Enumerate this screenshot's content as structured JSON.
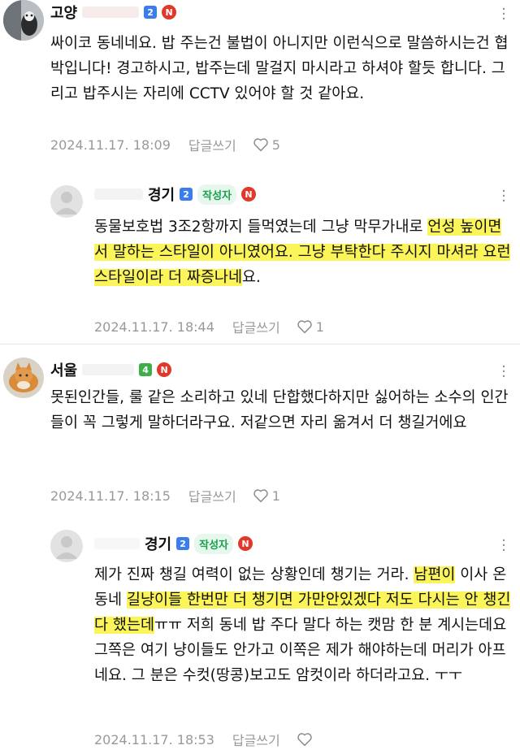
{
  "comments": [
    {
      "author": "고양",
      "level": "2",
      "level_color": "#3b7df0",
      "text": "싸이코 동네네요. 밥 주는건 불법이 아니지만 이런식으로 말씀하시는건 협박입니다! 경고하시고, 밥주는데 말걸지 마시라고 하셔야 할듯 합니다. 그리고 밥주시는 자리에 CCTV 있어야 할 것 같아요.",
      "date": "2024.11.17. 18:09",
      "reply_label": "답글쓰기",
      "likes": "5"
    },
    {
      "author": "경기",
      "level": "2",
      "level_color": "#3b7df0",
      "author_badge": "작성자",
      "text_parts": [
        {
          "t": "동물보호법 3조2항까지 들먹였는데 그냥 막무가내로 ",
          "h": false
        },
        {
          "t": "언성 높이면서 말하는 스타일이 아니였어요. 그냥 부탁한다 주시지 마셔라 요런 스타일이라 더 짜증나네",
          "h": true
        },
        {
          "t": "요.",
          "h": false
        }
      ],
      "date": "2024.11.17. 18:44",
      "reply_label": "답글쓰기",
      "likes": "1"
    },
    {
      "author": "서울",
      "level": "4",
      "level_color": "#3fae49",
      "text": "못된인간들, 룰 같은 소리하고 있네 단합했다하지만 싫어하는 소수의 인간들이 꼭 그렇게 말하더라구요. 저같으면 자리 옮겨서 더 챙길거에요",
      "date": "2024.11.17. 18:15",
      "reply_label": "답글쓰기",
      "likes": "1"
    },
    {
      "author": "경기",
      "level": "2",
      "level_color": "#3b7df0",
      "author_badge": "작성자",
      "text_parts": [
        {
          "t": "제가 진짜 챙길 여력이 없는 상황인데 챙기는 거라. ",
          "h": false
        },
        {
          "t": "남편이",
          "h": true
        },
        {
          "t": " 이사 온 동네 ",
          "h": false
        },
        {
          "t": "길냥이들 한번만 더 챙기면 가만안있겠다 저도 다시는 안 챙긴다 했는데",
          "h": true
        },
        {
          "t": "ㅠㅠ 저희 동네 밥 주다 말다 하는 캣맘 한 분 계시는데요 그쪽은 여기 냥이들도 안가고 이쪽은 제가 해야하는데 머리가 아프네요. 그 분은 수컷(땅콩)보고도 암컷이라 하더라고요. ㅜㅜ",
          "h": false
        }
      ],
      "date": "2024.11.17. 18:53",
      "reply_label": "답글쓰기",
      "likes": ""
    }
  ]
}
